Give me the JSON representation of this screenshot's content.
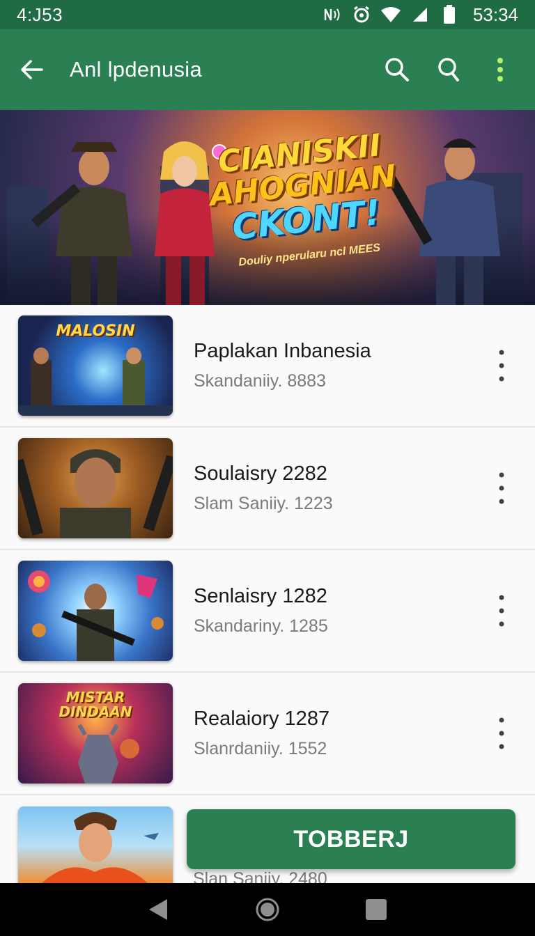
{
  "status": {
    "time_left": "4:J53",
    "time_right": "53:34",
    "icons": [
      "nfc-icon",
      "alarm-icon",
      "wifi-icon",
      "signal-icon",
      "battery-icon"
    ]
  },
  "app_bar": {
    "title": "Anl lpdenusia",
    "icons": [
      "back-arrow-icon",
      "search-icon",
      "search-icon",
      "more-vert-icon"
    ]
  },
  "banner": {
    "headline_line1": "CIANISKII",
    "headline_line2": "AHOGNIAN",
    "headline_line3": "CKONT!",
    "tagline": "Douliy nperularu ncl MEES"
  },
  "list": {
    "items": [
      {
        "title": "Paplakan Inbanesia",
        "subtitle": "Skandaniiy. 8883",
        "thumb_text": "MALOSIN"
      },
      {
        "title": "Soulaisry 2282",
        "subtitle": "Slam Saniiy. 1223",
        "thumb_text": ""
      },
      {
        "title": "Senlaisry 1282",
        "subtitle": "Skandariny. 1285",
        "thumb_text": ""
      },
      {
        "title": "Realaiory 1287",
        "subtitle": "Slanrdaniiy. 1552",
        "thumb_text": "MISTAR DINDAAN"
      },
      {
        "title": "",
        "subtitle": "Slan Saniiy. 2480",
        "thumb_text": ""
      }
    ]
  },
  "primary_button": {
    "label": "TOBBERJ"
  },
  "nav": {
    "icons": [
      "back-triangle-icon",
      "home-circle-icon",
      "recents-square-icon"
    ]
  },
  "colors": {
    "status_bar": "#1f6b44",
    "app_bar": "#2a8052",
    "button": "#2a8052"
  }
}
